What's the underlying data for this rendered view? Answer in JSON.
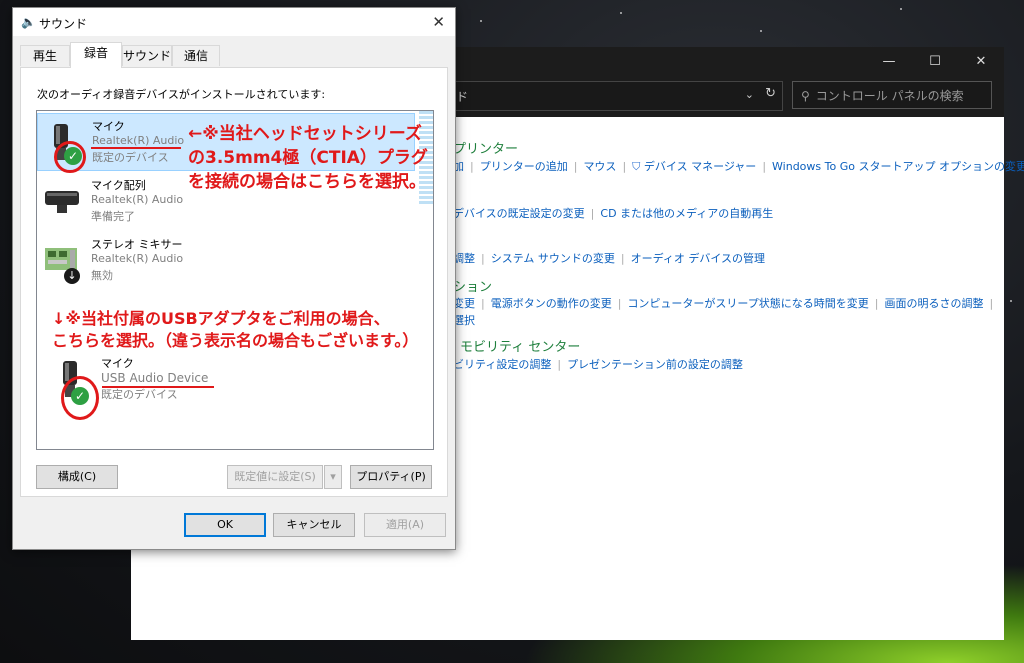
{
  "dialog": {
    "title": "サウンド",
    "tabs": [
      "再生",
      "録音",
      "サウンド",
      "通信"
    ],
    "active_tab": "録音",
    "instruction": "次のオーディオ録音デバイスがインストールされています:",
    "devices": [
      {
        "name": "マイク",
        "driver": "Realtek(R) Audio",
        "status": "既定のデバイス",
        "icon": "headset-mic-icon",
        "badge": "check"
      },
      {
        "name": "マイク配列",
        "driver": "Realtek(R) Audio",
        "status": "準備完了",
        "icon": "mic-array-icon",
        "badge": ""
      },
      {
        "name": "ステレオ ミキサー",
        "driver": "Realtek(R) Audio",
        "status": "無効",
        "icon": "circuit-board-icon",
        "badge": "down-arrow"
      },
      {
        "name": "マイク",
        "driver": "USB Audio Device",
        "status": "既定のデバイス",
        "icon": "headset-mic-icon",
        "badge": "check"
      }
    ],
    "buttons": {
      "configure": "構成(C)",
      "set_default": "既定値に設定(S)",
      "properties": "プロパティ(P)",
      "ok": "OK",
      "cancel": "キャンセル",
      "apply": "適用(A)"
    }
  },
  "annotations": {
    "note1": [
      "←※当社ヘッドセットシリーズ",
      "の3.5mm4極（CTIA）プラグ",
      "を接続の場合はこちらを選択。"
    ],
    "note2": [
      "↓※当社付属のUSBアダプタをご利用の場合、",
      "こちらを選択。（違う表示名の場合もございます。）"
    ],
    "color": "#e0191a"
  },
  "control_panel": {
    "window_controls": [
      "—",
      "☐",
      "✕"
    ],
    "address_fragment": "ド",
    "search_placeholder": "コントロール パネルの検索",
    "sections": [
      {
        "title": "プリンター",
        "links": [
          "プリンターの追加",
          "マウス",
          "デバイス マネージャー",
          "Windows To Go スタートアップ オプションの変更"
        ],
        "lead": "加"
      },
      {
        "title": "",
        "links": [
          "デバイスの既定設定の変更",
          "CD または他のメディアの自動再生"
        ]
      },
      {
        "title": "",
        "links": [
          "調整",
          "システム サウンドの変更",
          "オーディオ デバイスの管理"
        ]
      },
      {
        "title": "ション",
        "links": [
          "変更",
          "電源ボタンの動作の変更",
          "コンピューターがスリープ状態になる時間を変更",
          "画面の明るさの調整"
        ],
        "extra": "選択"
      },
      {
        "title": "モビリティ センター",
        "links": [
          "ビリティ設定の調整",
          "プレゼンテーション前の設定の調整"
        ]
      }
    ]
  }
}
